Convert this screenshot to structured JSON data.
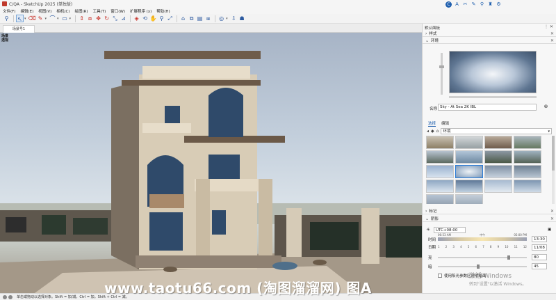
{
  "window": {
    "title": "C/QA - SketchUp 2025 (单独版)"
  },
  "menu": [
    "文件(F)",
    "编辑(E)",
    "视图(V)",
    "相机(C)",
    "绘图(R)",
    "工具(T)",
    "窗口(W)",
    "扩展程序 (x)",
    "帮助(H)"
  ],
  "document_tab": "场景号1",
  "scene_label": [
    "场景",
    "透视"
  ],
  "tray": {
    "title": "默认面板",
    "sections": {
      "styles": "样式",
      "environment": "环境",
      "tags": "标记",
      "shadows": "阴影"
    },
    "env_name_label": "名称",
    "env_name_value": "Sky - At Sea 2K IBL",
    "subtabs": [
      "选择",
      "编辑"
    ],
    "library_select": "环境"
  },
  "shadow": {
    "utc": "UTC+08:00",
    "time_label": "时间",
    "date_label": "日期",
    "light_label": "亮",
    "dark_label": "暗",
    "time_start": "06:53 AM",
    "time_mid": "中午",
    "time_end": "05:00 PM",
    "time_value": "13:30",
    "date_value": "11/08",
    "months": [
      "1",
      "2",
      "3",
      "4",
      "5",
      "6",
      "7",
      "8",
      "9",
      "10",
      "11",
      "12"
    ],
    "light_value": "80",
    "dark_value": "45",
    "sun_checkbox_label": "使用阳光参数区分明暗面"
  },
  "status": {
    "hint": "单击或拖动以选择对象。Shift = 加/减。Ctrl = 加。Shift + Ctrl = 减。"
  },
  "watermark": "www.taotu66.com (淘图溜溜网) 图A",
  "activation": {
    "line1": "激活 Windows",
    "line2": "转到\"设置\"以激活 Windows。"
  },
  "colors": {
    "accent": "#1f5fae",
    "record_red": "#c8322a"
  }
}
